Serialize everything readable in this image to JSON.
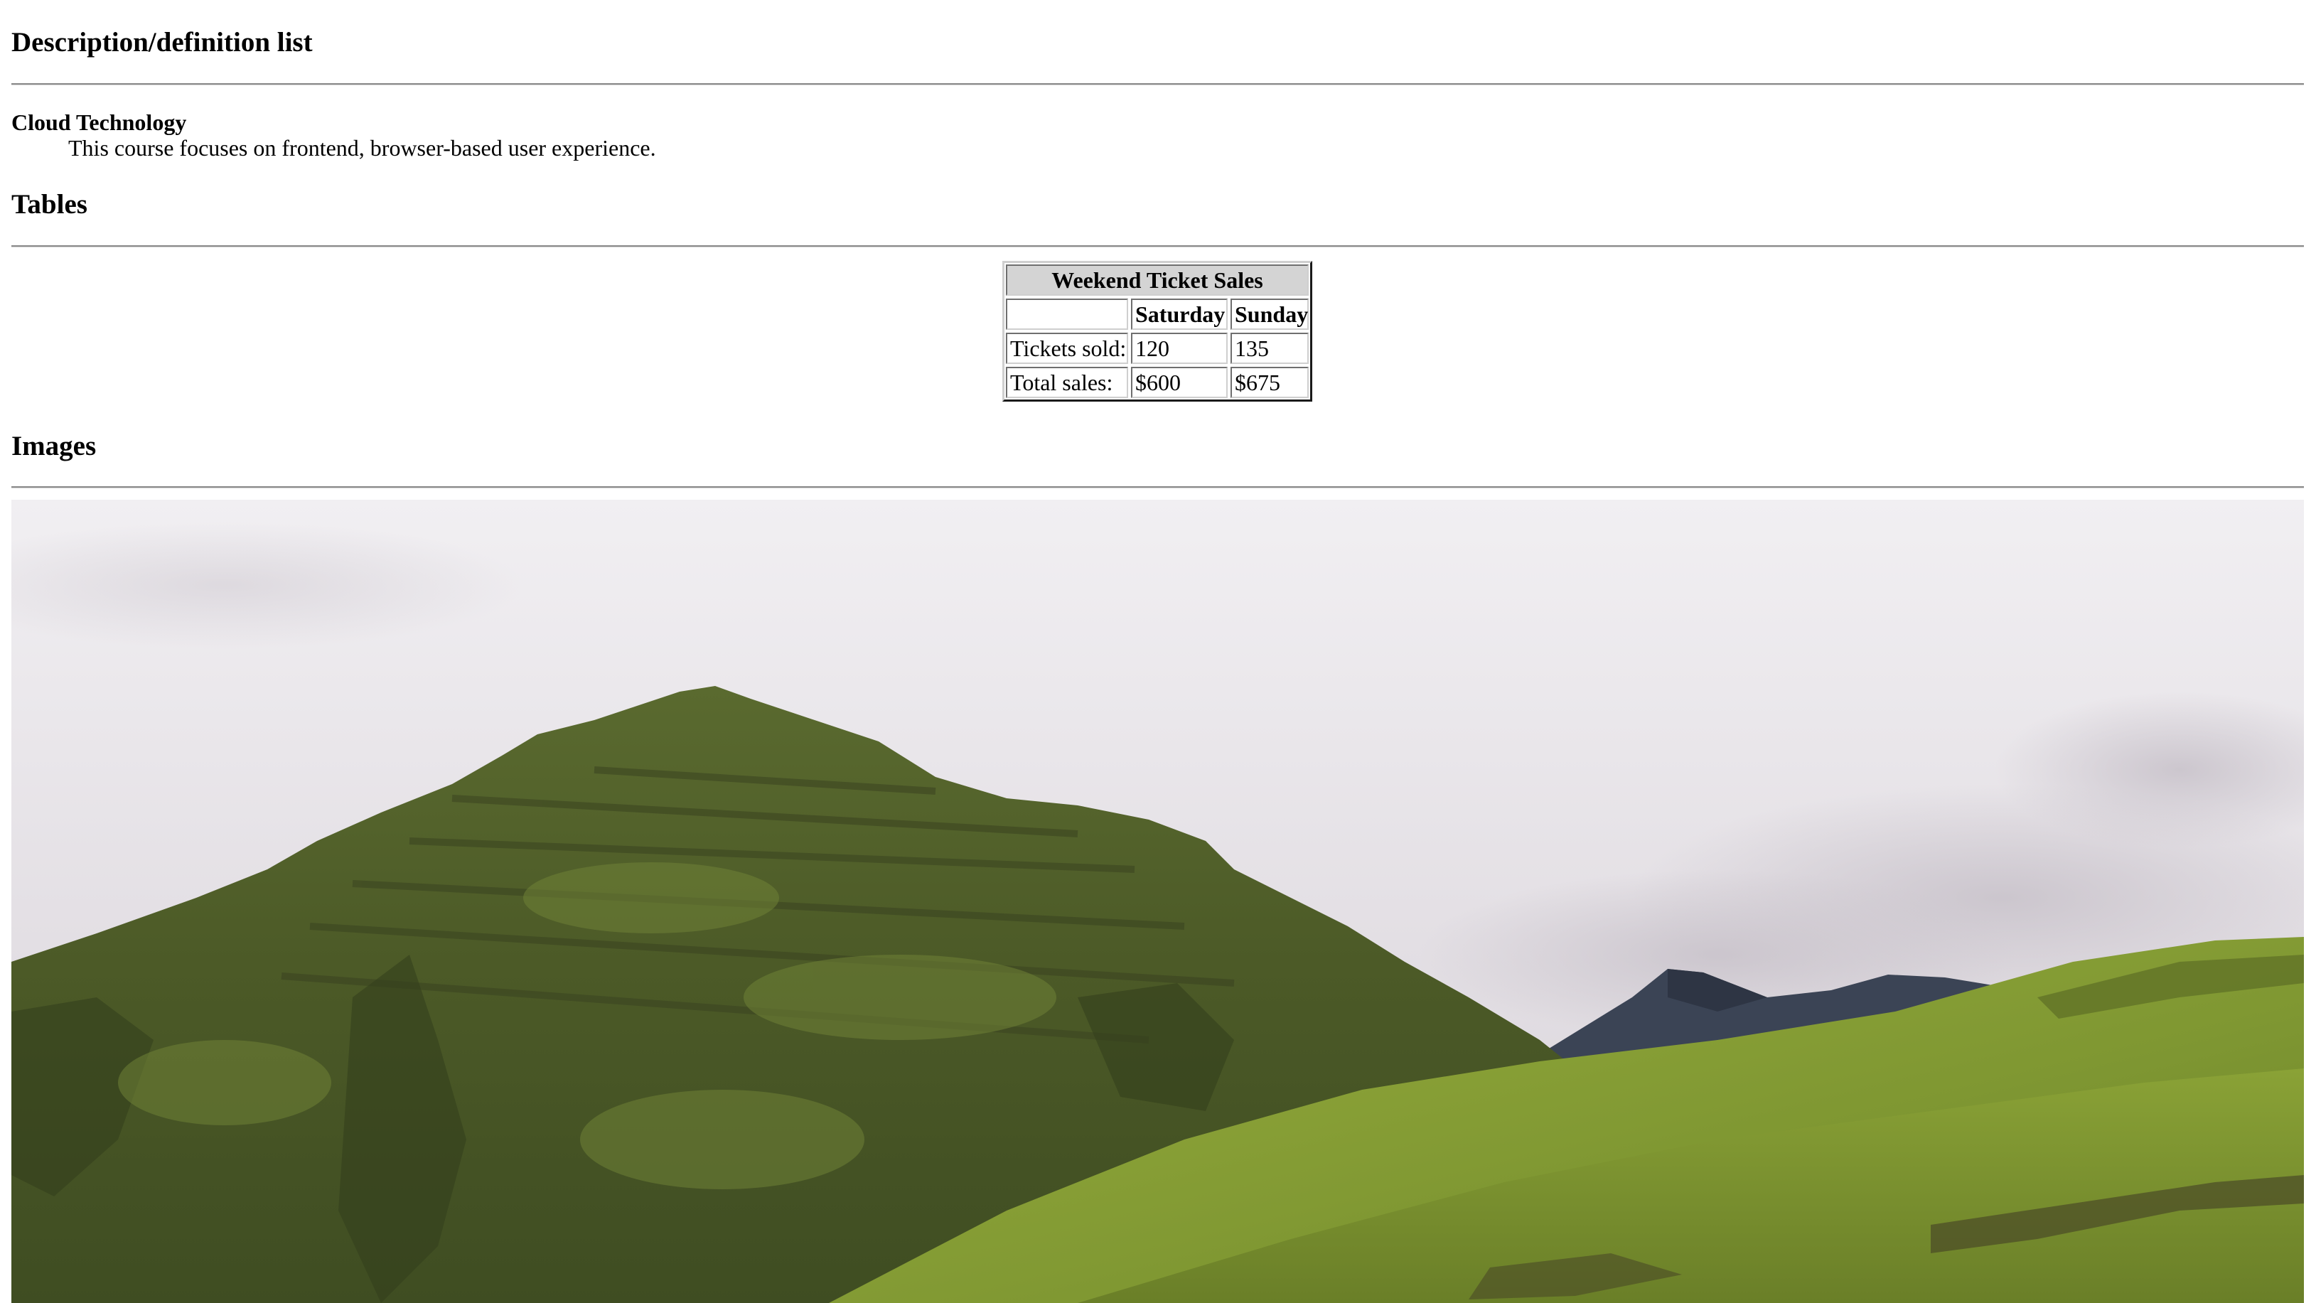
{
  "sections": {
    "description_list": "Description/definition list",
    "tables": "Tables",
    "images": "Images"
  },
  "definition_list": {
    "term": "Cloud Technology",
    "description": "This course focuses on frontend, browser-based user experience."
  },
  "table": {
    "caption": "Weekend Ticket Sales",
    "headers": [
      "",
      "Saturday",
      "Sunday"
    ],
    "rows": [
      [
        "Tickets sold:",
        "120",
        "135"
      ],
      [
        "Total sales:",
        "$600",
        "$675"
      ]
    ]
  },
  "image": {
    "alt": "",
    "colors": {
      "sky": "#e9e6ea",
      "mountain": "#4f5e2a",
      "grass": "#7c932f",
      "distant_peak": "#3b4455"
    }
  }
}
